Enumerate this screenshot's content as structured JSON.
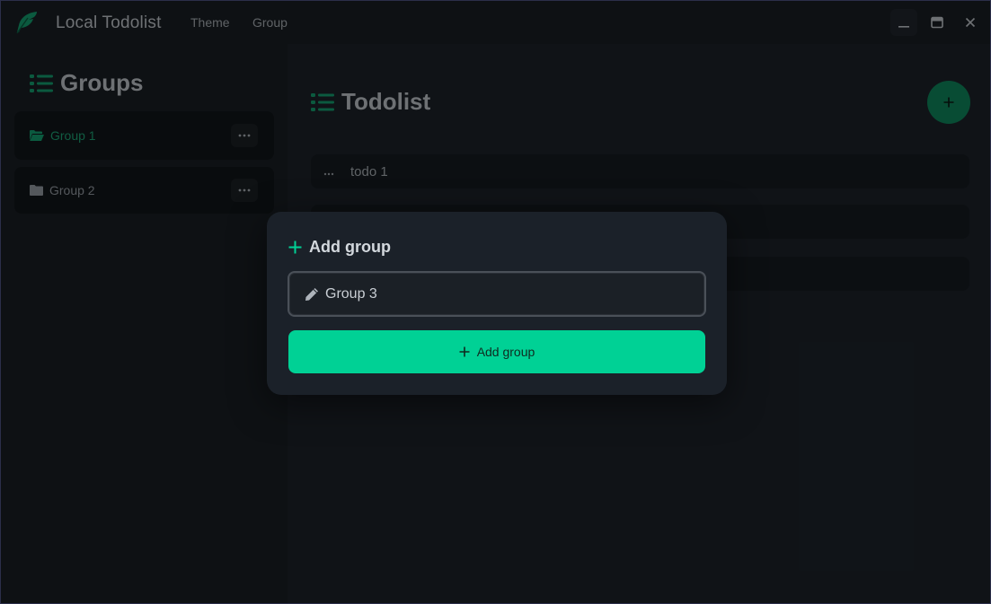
{
  "app": {
    "title": "Local Todolist",
    "accent": "#00d195",
    "logo_icon": "feather-icon"
  },
  "menu": [
    {
      "label": "Theme"
    },
    {
      "label": "Group"
    }
  ],
  "window_controls": [
    "minimize-icon",
    "maximize-icon",
    "close-icon"
  ],
  "sidebar": {
    "title": "Groups",
    "groups": [
      {
        "label": "Group 1",
        "active": true,
        "icon": "folder-open-icon"
      },
      {
        "label": "Group 2",
        "active": false,
        "icon": "folder-icon"
      }
    ]
  },
  "main": {
    "title": "Todolist",
    "todos": [
      {
        "text": "todo 1"
      },
      {
        "text": ""
      },
      {
        "text": ""
      }
    ]
  },
  "modal": {
    "title": "Add group",
    "input_value": "Group 3",
    "button_label": "Add group"
  }
}
